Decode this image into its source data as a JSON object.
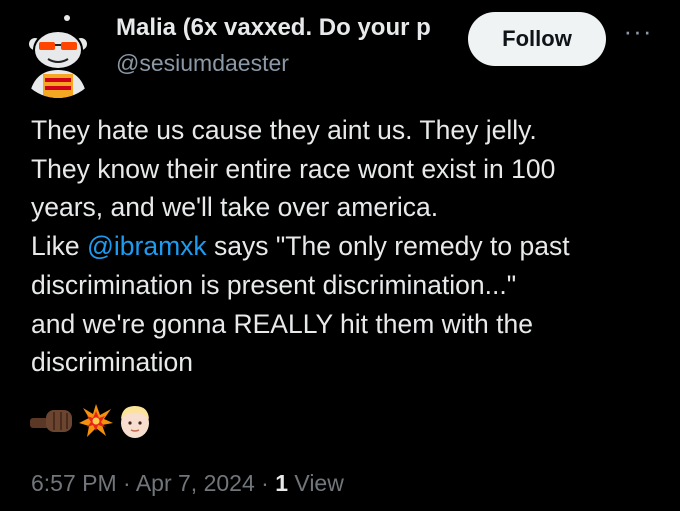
{
  "author": {
    "display_name": "Malia (6x vaxxed. Do your p",
    "handle": "@sesiumdaester"
  },
  "actions": {
    "follow_label": "Follow",
    "more_label": "···"
  },
  "post": {
    "lines": [
      {
        "before": "They hate us cause they aint us. They jelly."
      },
      {
        "before": "They know their entire race wont exist in 100"
      },
      {
        "before": "years, and we'll take over america."
      },
      {
        "before": "Like ",
        "mention": "@ibramxk",
        "after": " says \"The only remedy to past"
      },
      {
        "before": "discrimination is present discrimination...\""
      },
      {
        "before": "and we're gonna REALLY hit them with the"
      },
      {
        "before": "discrimination"
      }
    ],
    "emojis": [
      "fist-icon",
      "collision-icon",
      "face-icon"
    ]
  },
  "meta": {
    "time": "6:57 PM",
    "separator": " · ",
    "date": "Apr 7, 2024",
    "separator2": " · ",
    "views_count": "1",
    "views_label": " View"
  },
  "colors": {
    "background": "#000000",
    "text": "#e7e9ea",
    "secondary": "#71767b",
    "link": "#1d9bf0"
  }
}
